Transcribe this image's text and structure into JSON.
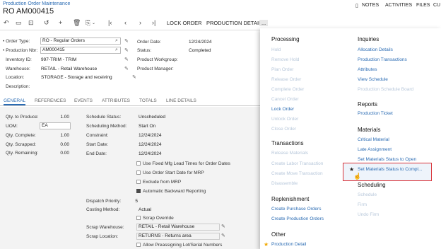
{
  "breadcrumb": "Production Order Maintenance",
  "page_title": "RO AM000415",
  "top_buttons": [
    "NOTES",
    "ACTIVITIES",
    "FILES",
    "CU"
  ],
  "toolbar": {
    "lock_order": "LOCK ORDER",
    "production_detail": "PRODUCTION DETAIL",
    "more": "..."
  },
  "header_form": {
    "order_type_label": "• Order Type:",
    "order_type_value": "RO - Regular Orders",
    "production_nbr_label": "• Production Nbr:",
    "production_nbr_value": "AM000415",
    "inventory_id_label": "Inventory ID:",
    "inventory_id_value": "997-TRIM - TRIM",
    "warehouse_label": "Warehouse:",
    "warehouse_value": "RETAIL - Retail Warehouse",
    "location_label": "Location:",
    "location_value": "STORAGE - Storage and receiving",
    "description_label": "Description:",
    "order_date_label": "Order Date:",
    "order_date_value": "12/24/2024",
    "status_label": "Status:",
    "status_value": "Completed",
    "product_workgroup_label": "Product Workgroup:",
    "product_manager_label": "Product Manager:"
  },
  "tabs": [
    "GENERAL",
    "REFERENCES",
    "EVENTS",
    "ATTRIBUTES",
    "TOTALS",
    "LINE DETAILS"
  ],
  "general": {
    "qty_to_produce_label": "Qty. to Produce:",
    "qty_to_produce": "1.00",
    "uom_label": "UOM:",
    "uom": "EA",
    "qty_complete_label": "Qty. Complete:",
    "qty_complete": "1.00",
    "qty_scrapped_label": "Qty. Scrapped:",
    "qty_scrapped": "0.00",
    "qty_remaining_label": "Qty. Remaining:",
    "qty_remaining": "0.00",
    "schedule_status_label": "Schedule Status:",
    "schedule_status": "Unscheduled",
    "scheduling_method_label": "Scheduling Method:",
    "scheduling_method": "Start On",
    "constraint_label": "Constraint:",
    "constraint": "12/24/2024",
    "start_date_label": "Start Date:",
    "start_date": "12/24/2024",
    "end_date_label": "End Date:",
    "end_date": "12/24/2024",
    "chk_fixed_mfg": "Use Fixed Mfg Lead Times for Order Dates",
    "chk_order_start": "Use Order Start Date for MRP",
    "chk_exclude_mrp": "Exclude from MRP",
    "chk_auto_backward": "Automatic Backward Reporting",
    "dispatch_priority_label": "Dispatch Priority:",
    "dispatch_priority": "5",
    "costing_method_label": "Costing Method:",
    "costing_method": "Actual",
    "chk_scrap_override": "Scrap Override",
    "scrap_warehouse_label": "Scrap Warehouse:",
    "scrap_warehouse": "RETAIL - Retail Warehouse",
    "scrap_location_label": "Scrap Location:",
    "scrap_location": "RETURNS - Returns area",
    "chk_allow_preassign": "Allow Preassigning Lot/Serial Numbers"
  },
  "menu": {
    "processing": {
      "title": "Processing",
      "items": [
        "Hold",
        "Remove Hold",
        "Plan Order",
        "Release Order",
        "Complete Order",
        "Cancel Order",
        "Lock Order",
        "Unlock Order",
        "Close Order"
      ]
    },
    "transactions": {
      "title": "Transactions",
      "items": [
        "Release Materials",
        "Create Labor Transaction",
        "Create Move Transaction",
        "Disassemble"
      ]
    },
    "replenishment": {
      "title": "Replenishment",
      "items": [
        "Create Purchase Orders",
        "Create Production Orders"
      ]
    },
    "other": {
      "title": "Other",
      "items": [
        "Production Detail"
      ]
    },
    "inquiries": {
      "title": "Inquiries",
      "items": [
        "Allocation Details",
        "Production Transactions",
        "Attributes",
        "View Schedule",
        "Production Schedule Board"
      ]
    },
    "reports": {
      "title": "Reports",
      "items": [
        "Production Ticket"
      ]
    },
    "materials": {
      "title": "Materials",
      "items": [
        "Critical Material",
        "Late Assignment",
        "Set Materials Status to Open",
        "Set Materials Status to Compl..."
      ]
    },
    "scheduling": {
      "title": "Scheduling",
      "items": [
        "Schedule",
        "Firm",
        "Undo Firm"
      ]
    }
  },
  "colors": {
    "link": "#2a6bb3",
    "disabled_link": "#b7c7da",
    "highlight_border": "#d9343a",
    "star": "#f0a800"
  }
}
